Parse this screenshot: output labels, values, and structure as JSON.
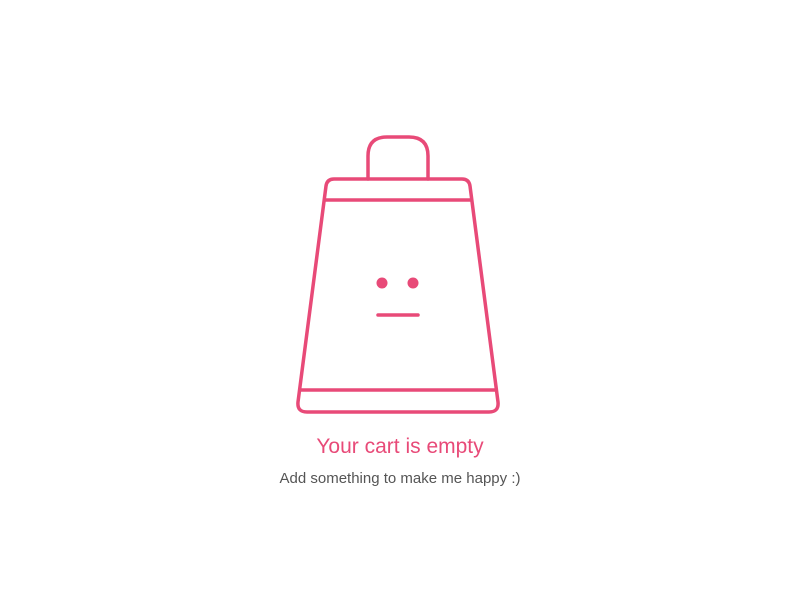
{
  "empty_state": {
    "illustration": "shopping-bag-neutral-face-icon",
    "title": "Your cart is empty",
    "subtitle": "Add something to make me happy :)"
  },
  "colors": {
    "accent": "#e84a78",
    "subtitle_text": "#555555",
    "background": "#ffffff"
  }
}
